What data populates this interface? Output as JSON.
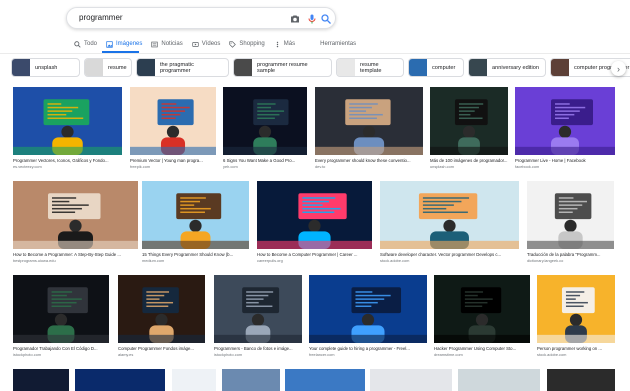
{
  "search": {
    "query": "programmer"
  },
  "tabs": [
    {
      "label": "Todo",
      "icon": "search-icon"
    },
    {
      "label": "Imágenes",
      "icon": "image-icon",
      "active": true
    },
    {
      "label": "Noticias",
      "icon": "news-icon"
    },
    {
      "label": "Vídeos",
      "icon": "video-icon"
    },
    {
      "label": "Shopping",
      "icon": "tag-icon"
    },
    {
      "label": "Más",
      "icon": "more-icon"
    },
    {
      "label": "Herramientas",
      "icon": ""
    }
  ],
  "chips": [
    {
      "label": "unsplash",
      "thumb_color": "#3b4a6b"
    },
    {
      "label": "resume",
      "thumb_color": "#d9d9d9"
    },
    {
      "label": "the pragmatic programmer",
      "thumb_color": "#2c3e50"
    },
    {
      "label": "programmer resume sample",
      "thumb_color": "#4a4a4a"
    },
    {
      "label": "resume template",
      "thumb_color": "#e8e8e8"
    },
    {
      "label": "computer",
      "thumb_color": "#2b6cb0"
    },
    {
      "label": "anniversary edition",
      "thumb_color": "#37474f"
    },
    {
      "label": "computer programmer",
      "thumb_color": "#5d4037"
    }
  ],
  "results": [
    {
      "caption": "Programmer Vectores, Iconos, Gráficos y Fondo...",
      "source": "es.vecteezy.com",
      "palette": [
        "#1e4fa8",
        "#f4b400",
        "#1aa260"
      ]
    },
    {
      "caption": "Premium Vector | Young man progra...",
      "source": "freepik.com",
      "palette": [
        "#f6dcc4",
        "#d93025",
        "#2b6cb0"
      ]
    },
    {
      "caption": "6 Signs You Want Make a Good Pro...",
      "source": "yeh.com",
      "palette": [
        "#0b1020",
        "#2e7d5b",
        "#1b2a40"
      ]
    },
    {
      "caption": "Every programmer should know these conventio...",
      "source": "dev.to",
      "palette": [
        "#2a2e37",
        "#6c8ebf",
        "#c9a27e"
      ]
    },
    {
      "caption": "Más de 100 imágenes de programador...",
      "source": "unsplash.com",
      "palette": [
        "#1b2b26",
        "#3f6b5c",
        "#111"
      ]
    },
    {
      "caption": "Programmer Live - Home | Facebook",
      "source": "facebook.com",
      "palette": [
        "#6a3fd6",
        "#9b7bf0",
        "#3a1d8c"
      ]
    },
    {
      "caption": "How to Become a Programmer: A Step-By-Step Guide ...",
      "source": "bestprograms.uiowa.edu",
      "palette": [
        "#b9896a",
        "#1a1a1a",
        "#e8d6c4"
      ]
    },
    {
      "caption": "15 Things Every Programmer Should Know (b...",
      "source": "medium.com",
      "palette": [
        "#9ad3f0",
        "#f5a623",
        "#5a3a22"
      ]
    },
    {
      "caption": "How to Become a Computer Programmer | Career ...",
      "source": "careerpulls.org",
      "palette": [
        "#071a3a",
        "#00b4ff",
        "#ff3b6b"
      ]
    },
    {
      "caption": "Software developer character. Vector programmer Develops c...",
      "source": "stock.adobe.com",
      "palette": [
        "#cfe6ee",
        "#1c5f78",
        "#f2a65a"
      ]
    },
    {
      "caption": "Traducción de la palabra \"Programm...",
      "source": "dictionary.langeek.co",
      "palette": [
        "#f2f2f2",
        "#c7c7c7",
        "#4d4d4d"
      ]
    },
    {
      "caption": "Programador Trabajando Con El Código D...",
      "source": "istockphoto.com",
      "palette": [
        "#0e1116",
        "#2c6e49",
        "#30343b"
      ]
    },
    {
      "caption": "Computer Programmer Fondos imáge...",
      "source": "alamy.es",
      "palette": [
        "#2a1a12",
        "#e0a86c",
        "#15283d"
      ]
    },
    {
      "caption": "Programmers - Banco de fotos e imáge...",
      "source": "istockphoto.com",
      "palette": [
        "#3d4a5a",
        "#9aa7b8",
        "#1e2732"
      ]
    },
    {
      "caption": "Your complete guide to hiring a programmer - Freel...",
      "source": "freelancer.com",
      "palette": [
        "#0a3d8f",
        "#3fa0ff",
        "#0a1e45"
      ]
    },
    {
      "caption": "Hacker Programmer Using Computer Sto...",
      "source": "dreamstime.com",
      "palette": [
        "#0f1a16",
        "#2b3a33",
        "#000"
      ]
    },
    {
      "caption": "Person programmer working on ...",
      "source": "stock.adobe.com",
      "palette": [
        "#f7b32b",
        "#2d3a4a",
        "#f5efe6"
      ]
    }
  ],
  "bottom_row_colors": [
    "#111b33",
    "#0a2a6b",
    "#eef2f6",
    "#6b8ab0",
    "#3b79c4",
    "#e4e6ea",
    "#cfd8dc",
    "#2b2b2b"
  ]
}
